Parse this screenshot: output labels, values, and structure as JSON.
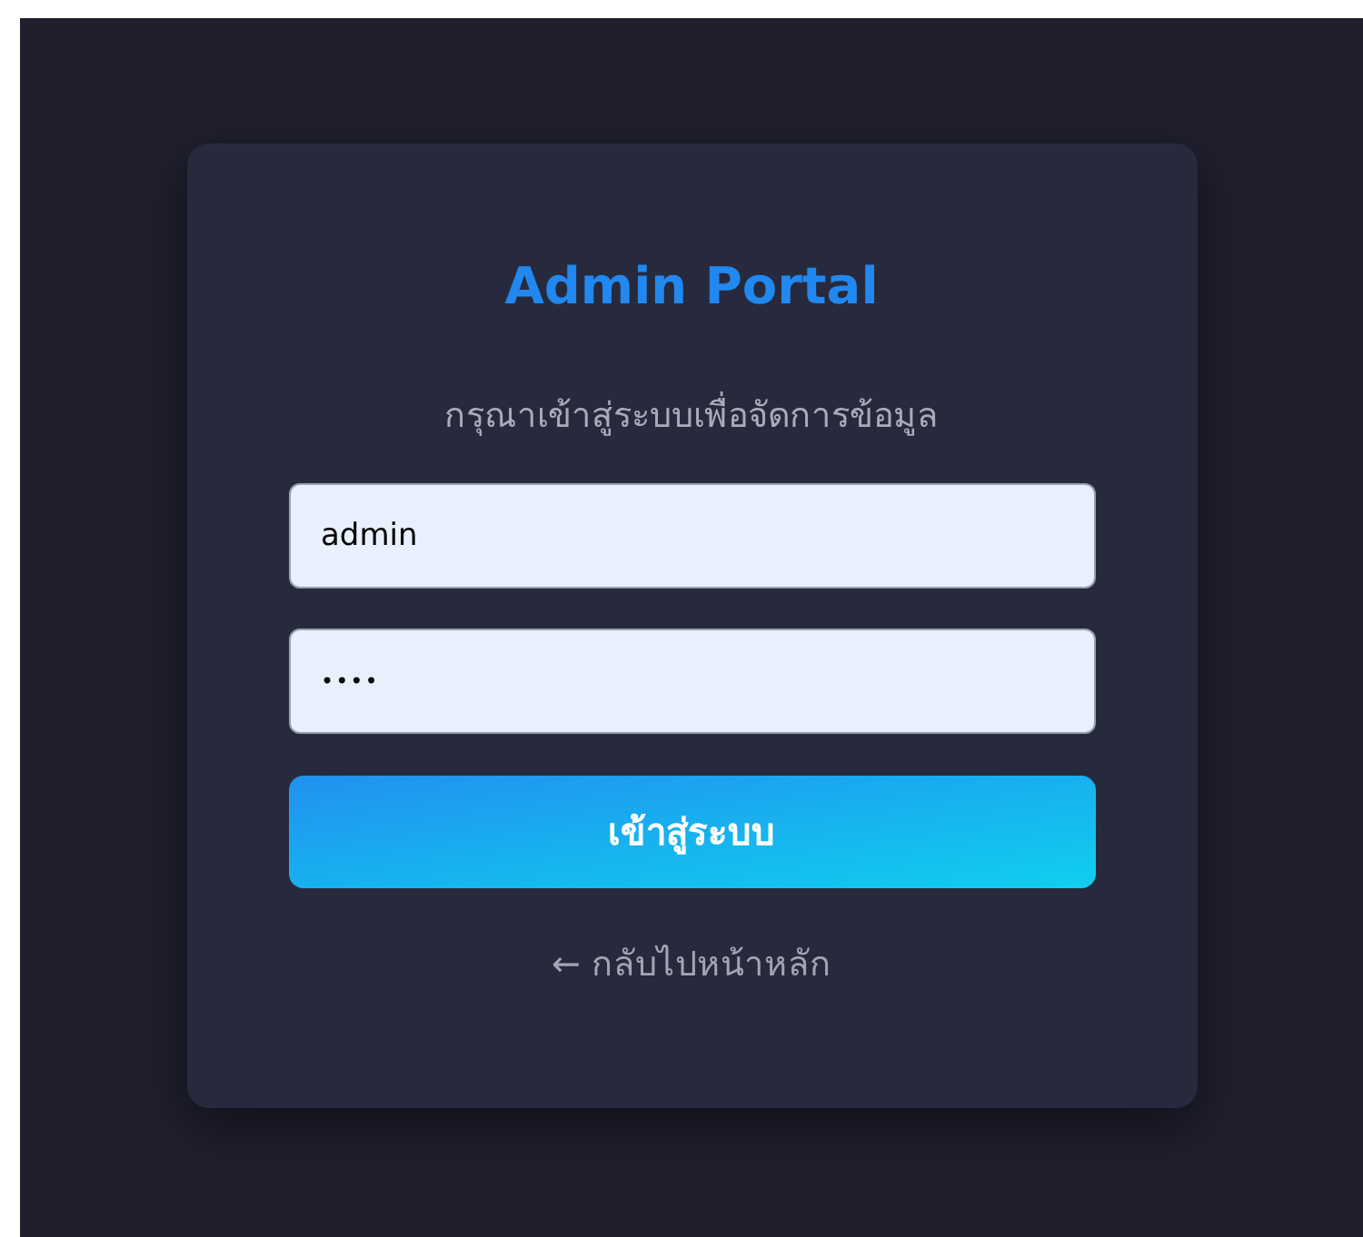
{
  "title": "Admin Portal",
  "subtitle": "กรุณาเข้าสู่ระบบเพื่อจัดการข้อมูล",
  "fields": [
    {
      "kind": "text",
      "value": "admin"
    },
    {
      "kind": "password",
      "value": "••••"
    }
  ],
  "login_button": "เข้าสู่ระบบ",
  "back_link": "← กลับไปหน้าหลัก"
}
